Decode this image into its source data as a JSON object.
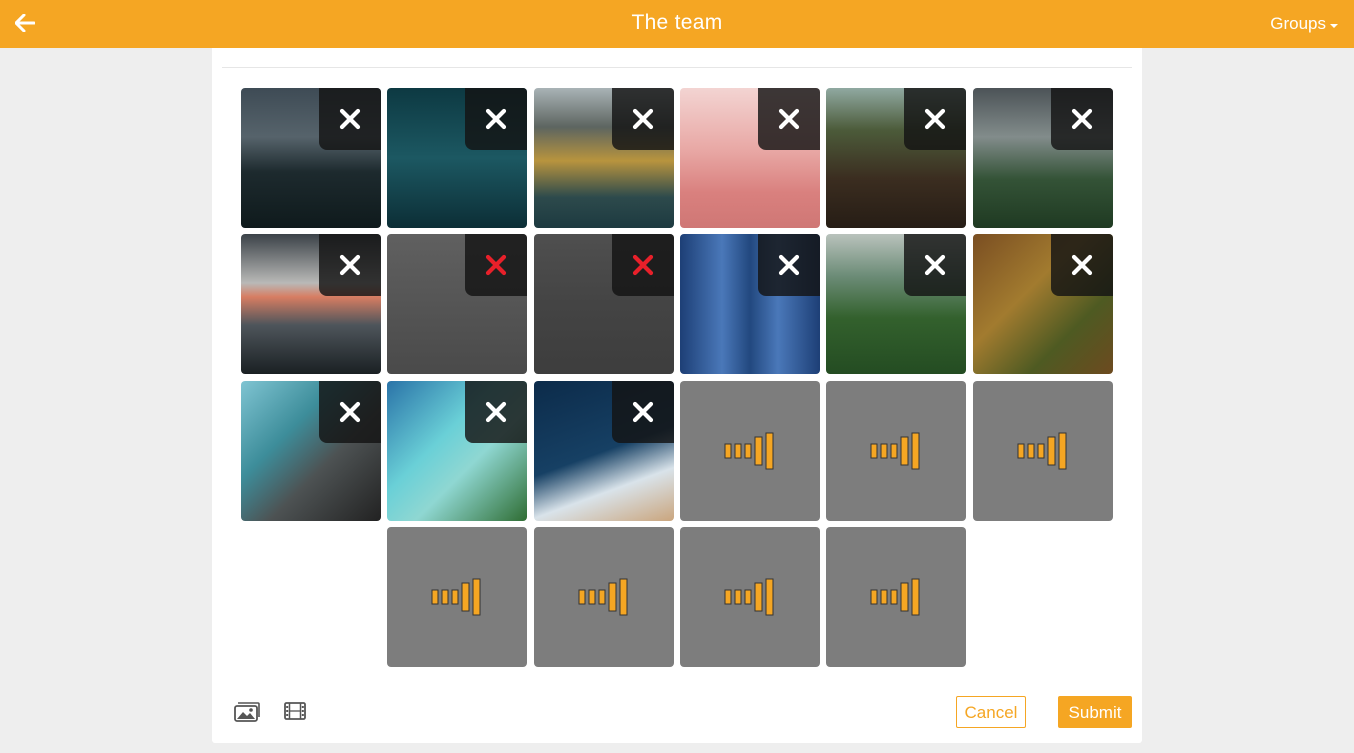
{
  "app": {
    "title": "The team"
  },
  "header": {
    "back_icon": "arrow-left-icon",
    "groups_label": "Groups",
    "groups_icon": "caret-down-icon"
  },
  "colors": {
    "accent": "#f5a623",
    "pending_tile": "#7d7d7d",
    "error_x": "#e8202a"
  },
  "grid": {
    "rows": [
      [
        {
          "kind": "image",
          "subject": "dark mountain lake with forest lights",
          "remove_state": "normal"
        },
        {
          "kind": "image",
          "subject": "aerial road between teal water",
          "remove_state": "normal"
        },
        {
          "kind": "image",
          "subject": "coastal volcano landscape",
          "remove_state": "normal"
        },
        {
          "kind": "image",
          "subject": "pink misty mountains",
          "remove_state": "normal"
        },
        {
          "kind": "image",
          "subject": "tall redwood forest looking up",
          "remove_state": "normal"
        },
        {
          "kind": "image",
          "subject": "green hillside under storm clouds",
          "remove_state": "normal"
        }
      ],
      [
        {
          "kind": "image",
          "subject": "snowy peaks at sunrise",
          "remove_state": "normal"
        },
        {
          "kind": "image",
          "subject": "blurred grey image",
          "remove_state": "error"
        },
        {
          "kind": "image",
          "subject": "blurred grey image",
          "remove_state": "error"
        },
        {
          "kind": "image",
          "subject": "symmetric blue architecture",
          "remove_state": "normal"
        },
        {
          "kind": "image",
          "subject": "aerial surf and forest",
          "remove_state": "normal"
        },
        {
          "kind": "image",
          "subject": "autumn forest from above",
          "remove_state": "normal"
        }
      ],
      [
        {
          "kind": "image",
          "subject": "aerial city by the sea",
          "remove_state": "normal"
        },
        {
          "kind": "image",
          "subject": "turquoise coast aerial",
          "remove_state": "normal"
        },
        {
          "kind": "image",
          "subject": "waves on sandy beach",
          "remove_state": "normal"
        },
        {
          "kind": "pending",
          "icon": "loading-bars-icon"
        },
        {
          "kind": "pending",
          "icon": "loading-bars-icon"
        },
        {
          "kind": "pending",
          "icon": "loading-bars-icon"
        }
      ],
      [
        {
          "kind": "empty"
        },
        {
          "kind": "pending",
          "icon": "loading-bars-icon"
        },
        {
          "kind": "pending",
          "icon": "loading-bars-icon"
        },
        {
          "kind": "pending",
          "icon": "loading-bars-icon"
        },
        {
          "kind": "pending",
          "icon": "loading-bars-icon"
        },
        {
          "kind": "empty"
        }
      ]
    ]
  },
  "footer": {
    "gallery_icon": "photo-gallery-icon",
    "video_icon": "film-strip-icon",
    "cancel_label": "Cancel",
    "submit_label": "Submit"
  }
}
